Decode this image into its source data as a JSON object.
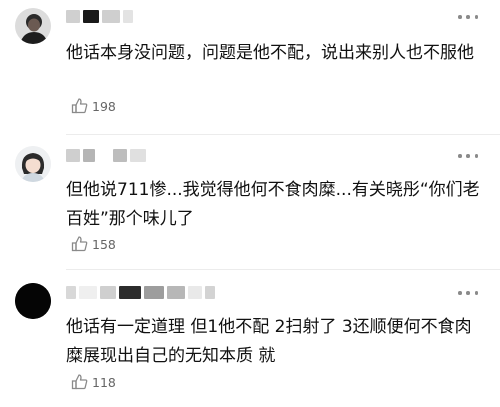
{
  "comments": [
    {
      "text": "他话本身没问题，问题是他不配，说出来别人也不服他",
      "likes": "198",
      "avatar": "man-dark-avatar"
    },
    {
      "text": "但他说711惨...我觉得他何不食肉糜...有关晓彤“你们老百姓”那个味儿了",
      "likes": "158",
      "avatar": "girl-cartoon-avatar"
    },
    {
      "text": "他话有一定道理 但1他不配 2扫射了 3还顺便何不食肉糜展现出自己的无知本质 就",
      "likes": "118",
      "avatar": "black-circle-avatar"
    }
  ],
  "colors": {
    "text": "#111111",
    "meta": "#666666",
    "icon": "#8a8a8a"
  }
}
